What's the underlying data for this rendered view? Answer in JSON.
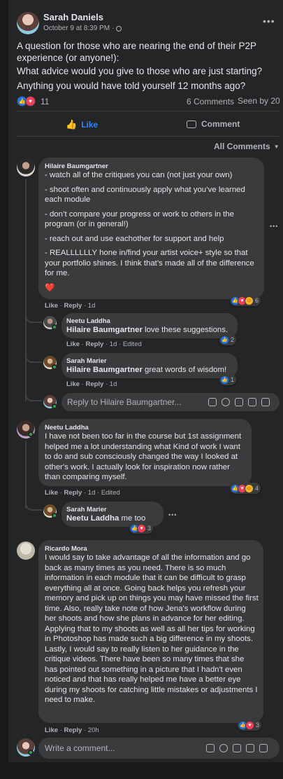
{
  "post": {
    "author": "Sarah Daniels",
    "date": "October 9 at 8:39 PM",
    "visibility_icon": "globe-icon",
    "text": [
      "A question for those who are nearing the end of their P2P experience (or anyone!):",
      "What advice would you give to those who are just starting?",
      "Anything you would have told yourself 12 months ago?"
    ],
    "reaction_count": "11",
    "comments_count": "6 Comments",
    "seen_by": "Seen by 20",
    "like_label": "Like",
    "comment_label": "Comment",
    "sort_label": "All Comments"
  },
  "comments": [
    {
      "author": "Hilaire Baumgartner",
      "paragraphs": [
        "- watch all of the critiques you can (not just your own)",
        "- shoot often and continuously apply what you’ve learned each module",
        "- don’t compare your progress or work to others in the program (or in general!)",
        "- reach out and use eachother for support and help",
        "- REALLLLLLY hone in/find your artist voice+ style so that your portfolio shines. I think that’s made all of the difference for me."
      ],
      "emoji": "❤️",
      "like": "Like",
      "reply": "Reply",
      "time": "1d",
      "reactions": "6",
      "replies": [
        {
          "author": "Neetu Laddha",
          "mention": "Hilaire Baumgartner",
          "text": " love these suggestions.",
          "like": "Like",
          "reply": "Reply",
          "time": "1d",
          "edited": "Edited",
          "reactions": "2"
        },
        {
          "author": "Sarah Marier",
          "mention": "Hilaire Baumgartner",
          "text": " great words of wisdom!",
          "like": "Like",
          "reply": "Reply",
          "time": "1d",
          "reactions": "1"
        }
      ],
      "reply_placeholder": "Reply to Hilaire Baumgartner..."
    },
    {
      "author": "Neetu Laddha",
      "text": "I have not been too far in the course but 1st assignment helped me a lot understanding what Kind of work I want to do and sub consciously changed the way I looked at other's work. I actually look for inspiration now rather than comparing myself.",
      "like": "Like",
      "reply": "Reply",
      "time": "1d",
      "edited": "Edited",
      "reactions": "4",
      "replies": [
        {
          "author": "Sarah Marier",
          "mention": "Neetu Laddha",
          "text": " me too",
          "reactions": "3"
        }
      ]
    },
    {
      "author": "Ricardo Mora",
      "text": "I would say to take advantage of all the information and go back as many times as you need. There is so much information in each module that it can be difficult to grasp everything all at once. Going back helps you refresh your memory and pick up on things you may have missed the first time. Also, really take note of how Jena's workflow during her shoots and how she plans in advance for her editing. Applying that to my shoots as well as all her tips for working in Photoshop has made such a big difference in my shoots. Lastly, I would say to really listen to her guidance in the critique videos. There have been so many times that she has pointed out something in a picture that I hadn't even noticed and that has really helped me have a better eye during my shoots for catching little mistakes or adjustments I need to make.",
      "like": "Like",
      "reply": "Reply",
      "time": "20h",
      "reactions": "3"
    }
  ],
  "composer": {
    "placeholder": "Write a comment..."
  },
  "colors": {
    "background": "#242526",
    "bubble": "#3a3b3c",
    "accent": "#2d88ff",
    "text": "#e4e6eb",
    "muted": "#b0b3b8"
  }
}
